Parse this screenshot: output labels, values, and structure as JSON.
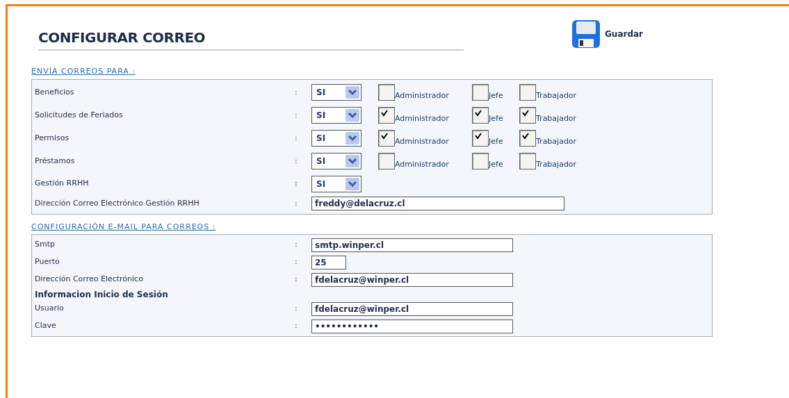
{
  "title": "CONFIGURAR CORREO",
  "save_button": {
    "label": "Guardar"
  },
  "send_section": {
    "heading": "ENVÍA CORREOS PARA :",
    "rows": [
      {
        "kind": "select_checks",
        "label": "Beneficios",
        "separator": ":",
        "value": "SI",
        "checks": [
          {
            "label": "Administrador",
            "checked": false
          },
          {
            "label": "Jefe",
            "checked": false
          },
          {
            "label": "Trabajador",
            "checked": false
          }
        ]
      },
      {
        "kind": "select_checks",
        "label": "Solicitudes de Feriados",
        "separator": ":",
        "value": "SI",
        "checks": [
          {
            "label": "Administrador",
            "checked": true
          },
          {
            "label": "Jefe",
            "checked": true
          },
          {
            "label": "Trabajador",
            "checked": true
          }
        ]
      },
      {
        "kind": "select_checks",
        "label": "Permisos",
        "separator": ":",
        "value": "SI",
        "checks": [
          {
            "label": "Administrador",
            "checked": true
          },
          {
            "label": "Jefe",
            "checked": true
          },
          {
            "label": "Trabajador",
            "checked": true
          }
        ]
      },
      {
        "kind": "select_checks",
        "label": "Préstamos",
        "separator": ":",
        "value": "SI",
        "checks": [
          {
            "label": "Administrador",
            "checked": false
          },
          {
            "label": "Jefe",
            "checked": false
          },
          {
            "label": "Trabajador",
            "checked": false
          }
        ]
      },
      {
        "kind": "select",
        "label": "Gestión RRHH",
        "separator": ":",
        "value": "SI"
      },
      {
        "kind": "text",
        "label": "Dirección Correo Electrónico Gestión RRHH",
        "separator": ":",
        "value": "freddy@delacruz.cl"
      }
    ]
  },
  "mail_section": {
    "heading": "CONFIGURACIÓN E-MAIL PARA CORREOS :",
    "rows": [
      {
        "kind": "text",
        "label": "Smtp",
        "separator": ":",
        "value": "smtp.winper.cl"
      },
      {
        "kind": "number",
        "label": "Puerto",
        "separator": ":",
        "value": "25"
      },
      {
        "kind": "text",
        "label": "Dirección Correo Electrónico",
        "separator": ":",
        "value": "fdelacruz@winper.cl"
      },
      {
        "kind": "subheading",
        "label": "Informacion Inicio de Sesión"
      },
      {
        "kind": "text",
        "label": "Usuario",
        "separator": ":",
        "value": "fdelacruz@winper.cl"
      },
      {
        "kind": "text",
        "label": "Clave",
        "separator": ":",
        "value": "••••••••••••"
      }
    ]
  }
}
